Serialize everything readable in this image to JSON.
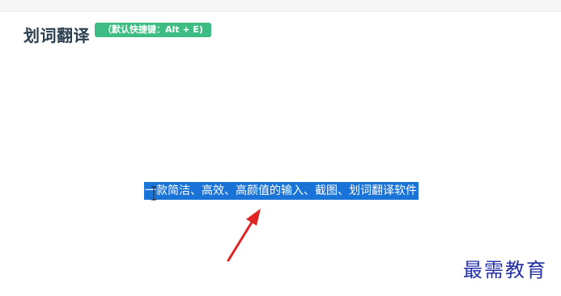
{
  "header": {
    "title": "划词翻译",
    "shortcut_badge": "（默认快捷键：Alt + E)"
  },
  "content": {
    "selected_text": "一款简洁、高效、高颜值的输入、截图、划词翻译软件"
  },
  "watermark": {
    "text": "最需教育"
  },
  "colors": {
    "badge_bg": "#3dbd84",
    "selection_bg": "#1a73d6",
    "arrow": "#e02424",
    "watermark": "#2530a8",
    "title": "#2b3f4f"
  }
}
